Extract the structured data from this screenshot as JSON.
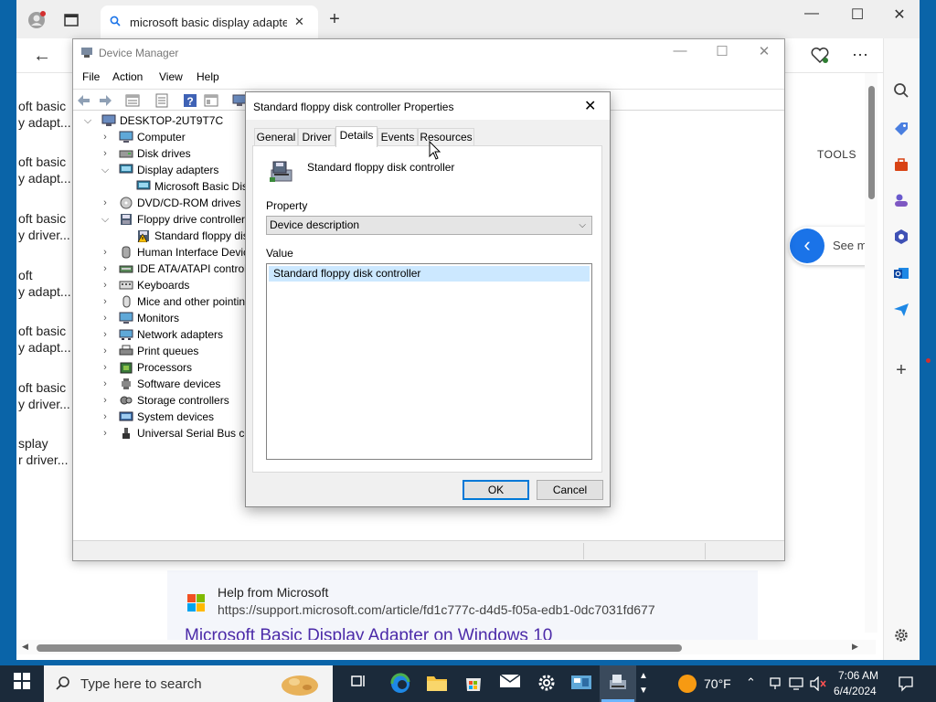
{
  "browser": {
    "tab_title": "microsoft basic display adapter u",
    "left_column": [
      {
        "l1": "oft basic",
        "l2": "y adapt..."
      },
      {
        "l1": "oft basic",
        "l2": "y adapt..."
      },
      {
        "l1": "oft basic",
        "l2": "y driver..."
      },
      {
        "l1": "oft",
        "l2": "y adapt..."
      },
      {
        "l1": "oft basic",
        "l2": "y adapt..."
      },
      {
        "l1": "oft basic",
        "l2": "y driver..."
      },
      {
        "l1": "splay",
        "l2": "r driver..."
      }
    ],
    "tools_label": "TOOLS",
    "see_more_label": "See m",
    "help": {
      "heading": "Help from Microsoft",
      "url": "https://support.microsoft.com/article/fd1c777c-d4d5-f05a-edb1-0dc7031fd677",
      "link_title": "Microsoft Basic Display Adapter on Windows 10"
    }
  },
  "device_manager": {
    "title": "Device Manager",
    "menu": [
      "File",
      "Action",
      "View",
      "Help"
    ],
    "tree": [
      {
        "label": "DESKTOP-2UT9T7C",
        "level": 0,
        "state": "expanded",
        "icon": "computer-icon"
      },
      {
        "label": "Computer",
        "level": 1,
        "state": "collapsed",
        "icon": "monitor-icon"
      },
      {
        "label": "Disk drives",
        "level": 1,
        "state": "collapsed",
        "icon": "disk-icon"
      },
      {
        "label": "Display adapters",
        "level": 1,
        "state": "expanded",
        "icon": "display-icon"
      },
      {
        "label": "Microsoft Basic Display Adapter",
        "level": 2,
        "state": "leaf",
        "icon": "display-icon"
      },
      {
        "label": "DVD/CD-ROM drives",
        "level": 1,
        "state": "collapsed",
        "icon": "dvd-icon"
      },
      {
        "label": "Floppy drive controllers",
        "level": 1,
        "state": "expanded",
        "icon": "floppy-icon"
      },
      {
        "label": "Standard floppy disk controller",
        "level": 2,
        "state": "leaf",
        "icon": "floppy-warning-icon"
      },
      {
        "label": "Human Interface Devices",
        "level": 1,
        "state": "collapsed",
        "icon": "hid-icon"
      },
      {
        "label": "IDE ATA/ATAPI controllers",
        "level": 1,
        "state": "collapsed",
        "icon": "ide-icon"
      },
      {
        "label": "Keyboards",
        "level": 1,
        "state": "collapsed",
        "icon": "keyboard-icon"
      },
      {
        "label": "Mice and other pointing devices",
        "level": 1,
        "state": "collapsed",
        "icon": "mouse-icon"
      },
      {
        "label": "Monitors",
        "level": 1,
        "state": "collapsed",
        "icon": "monitor-icon"
      },
      {
        "label": "Network adapters",
        "level": 1,
        "state": "collapsed",
        "icon": "network-icon"
      },
      {
        "label": "Print queues",
        "level": 1,
        "state": "collapsed",
        "icon": "printer-icon"
      },
      {
        "label": "Processors",
        "level": 1,
        "state": "collapsed",
        "icon": "cpu-icon"
      },
      {
        "label": "Software devices",
        "level": 1,
        "state": "collapsed",
        "icon": "software-icon"
      },
      {
        "label": "Storage controllers",
        "level": 1,
        "state": "collapsed",
        "icon": "storage-icon"
      },
      {
        "label": "System devices",
        "level": 1,
        "state": "collapsed",
        "icon": "system-icon"
      },
      {
        "label": "Universal Serial Bus controllers",
        "level": 1,
        "state": "collapsed",
        "icon": "usb-icon"
      }
    ]
  },
  "dialog": {
    "title": "Standard floppy disk controller Properties",
    "tabs": [
      "General",
      "Driver",
      "Details",
      "Events",
      "Resources"
    ],
    "active_tab": "Details",
    "device_name": "Standard floppy disk controller",
    "property_label": "Property",
    "property_value": "Device description",
    "value_label": "Value",
    "value_items": [
      "Standard floppy disk controller"
    ],
    "ok_label": "OK",
    "cancel_label": "Cancel"
  },
  "taskbar": {
    "search_placeholder": "Type here to search",
    "temperature": "70°F",
    "time": "7:06 AM",
    "date": "6/4/2024"
  },
  "colors": {
    "accent": "#0078d7",
    "selection": "#cce8ff",
    "taskbar": "#1b2a3a",
    "link": "#4b2aa8"
  }
}
